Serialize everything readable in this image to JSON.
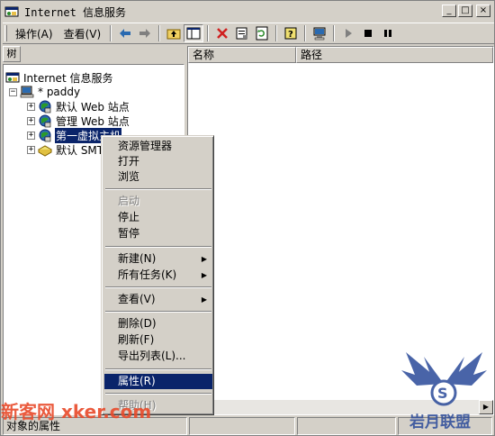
{
  "window": {
    "title": "Internet 信息服务",
    "controls": {
      "minimize": "_",
      "maximize": "□",
      "close": "×"
    }
  },
  "toolbar": {
    "action_label": "操作(A)",
    "view_label": "查看(V)",
    "icons": [
      "back-arrow-icon",
      "forward-arrow-icon",
      "up-folder-icon",
      "show-tree-icon",
      "delete-icon",
      "properties-icon",
      "refresh-icon",
      "help-icon",
      "computer-icon",
      "play-icon",
      "stop-icon",
      "pause-icon"
    ]
  },
  "tree": {
    "tab_label": "树",
    "root": "Internet 信息服务",
    "server": "* paddy",
    "items": [
      {
        "label": "默认 Web 站点"
      },
      {
        "label": "管理 Web 站点"
      },
      {
        "label": "第一虚拟主机",
        "selected": true
      },
      {
        "label": "默认 SMTP"
      }
    ]
  },
  "list": {
    "columns": [
      "名称",
      "路径"
    ]
  },
  "status": {
    "text": "对象的属性"
  },
  "context_menu": {
    "items": [
      {
        "label": "资源管理器",
        "enabled": true
      },
      {
        "label": "打开",
        "enabled": true
      },
      {
        "label": "浏览",
        "enabled": true
      },
      {
        "label": "启动",
        "enabled": false
      },
      {
        "label": "停止",
        "enabled": true
      },
      {
        "label": "暂停",
        "enabled": true
      },
      {
        "label": "新建(N)",
        "enabled": true,
        "submenu": true
      },
      {
        "label": "所有任务(K)",
        "enabled": true,
        "submenu": true
      },
      {
        "label": "查看(V)",
        "enabled": true,
        "submenu": true
      },
      {
        "label": "删除(D)",
        "enabled": true
      },
      {
        "label": "刷新(F)",
        "enabled": true
      },
      {
        "label": "导出列表(L)...",
        "enabled": true
      },
      {
        "label": "属性(R)",
        "enabled": true,
        "highlighted": true
      },
      {
        "label": "帮助(H)",
        "enabled": false
      }
    ]
  },
  "watermarks": {
    "left": "新客网 xker.com",
    "logo_text": "岩月联盟"
  },
  "colors": {
    "face": "#d4d0c8",
    "highlight": "#0a246a",
    "watermark": "#e84a2a",
    "logo": "#2a4a9a"
  }
}
